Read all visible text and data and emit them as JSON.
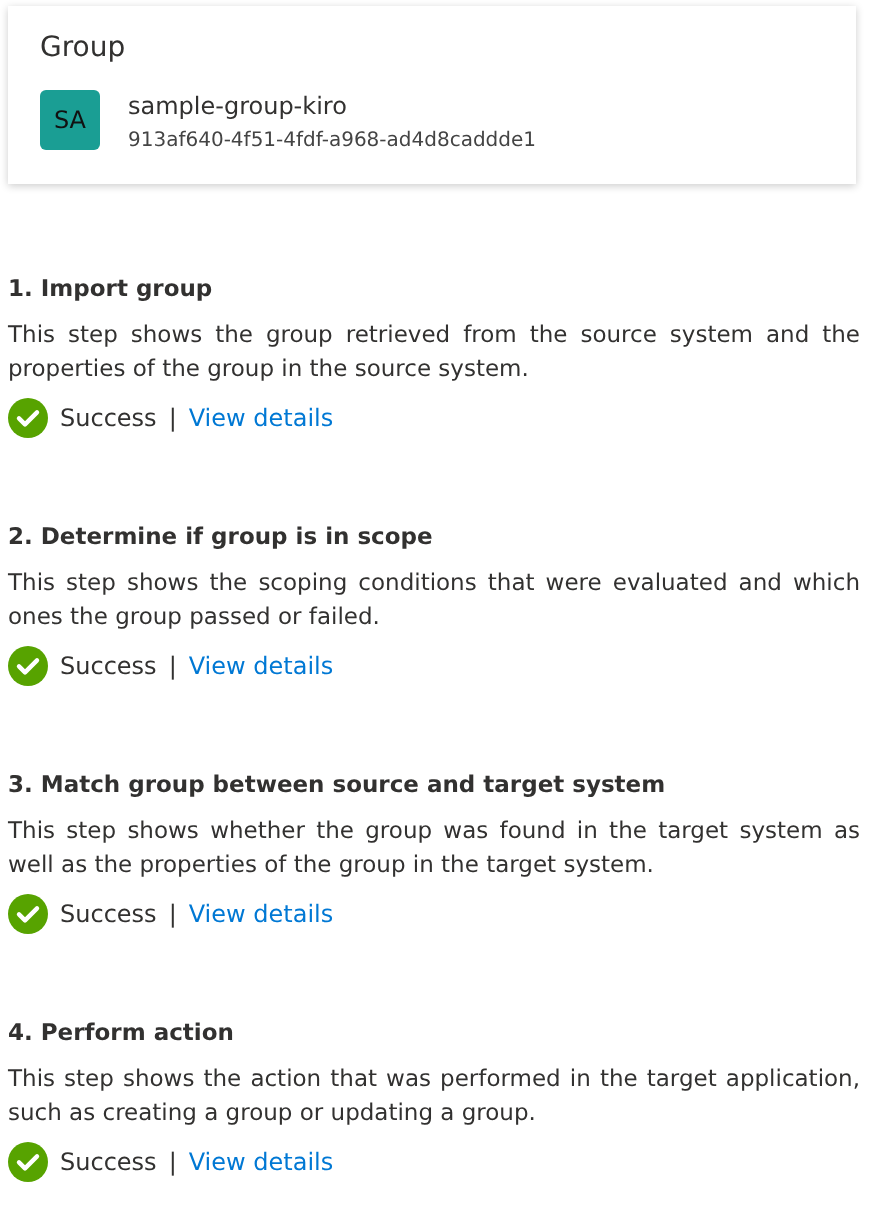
{
  "group_card": {
    "title": "Group",
    "avatar": "SA",
    "name": "sample-group-kiro",
    "id": "913af640-4f51-4fdf-a968-ad4d8caddde1"
  },
  "steps": [
    {
      "title": "1. Import group",
      "description": "This step shows the group retrieved from the source system and the properties of the group in the source system.",
      "kind": "success",
      "status_label": "Success",
      "separator": "|",
      "link": "View details"
    },
    {
      "title": "2. Determine if group is in scope",
      "description": "This step shows the scoping conditions that were evaluated and which ones the group passed or failed.",
      "kind": "success",
      "status_label": "Success",
      "separator": "|",
      "link": "View details"
    },
    {
      "title": "3. Match group between source and target system",
      "description": "This step shows whether the group was found in the target system as well as the properties of the group in the target system.",
      "kind": "success",
      "status_label": "Success",
      "separator": "|",
      "link": "View details"
    },
    {
      "title": "4. Perform action",
      "description": "This step shows the action that was performed in the target application, such as creating a group or updating a group.",
      "kind": "success",
      "status_label": "Success",
      "separator": "|",
      "link": "View details"
    }
  ]
}
